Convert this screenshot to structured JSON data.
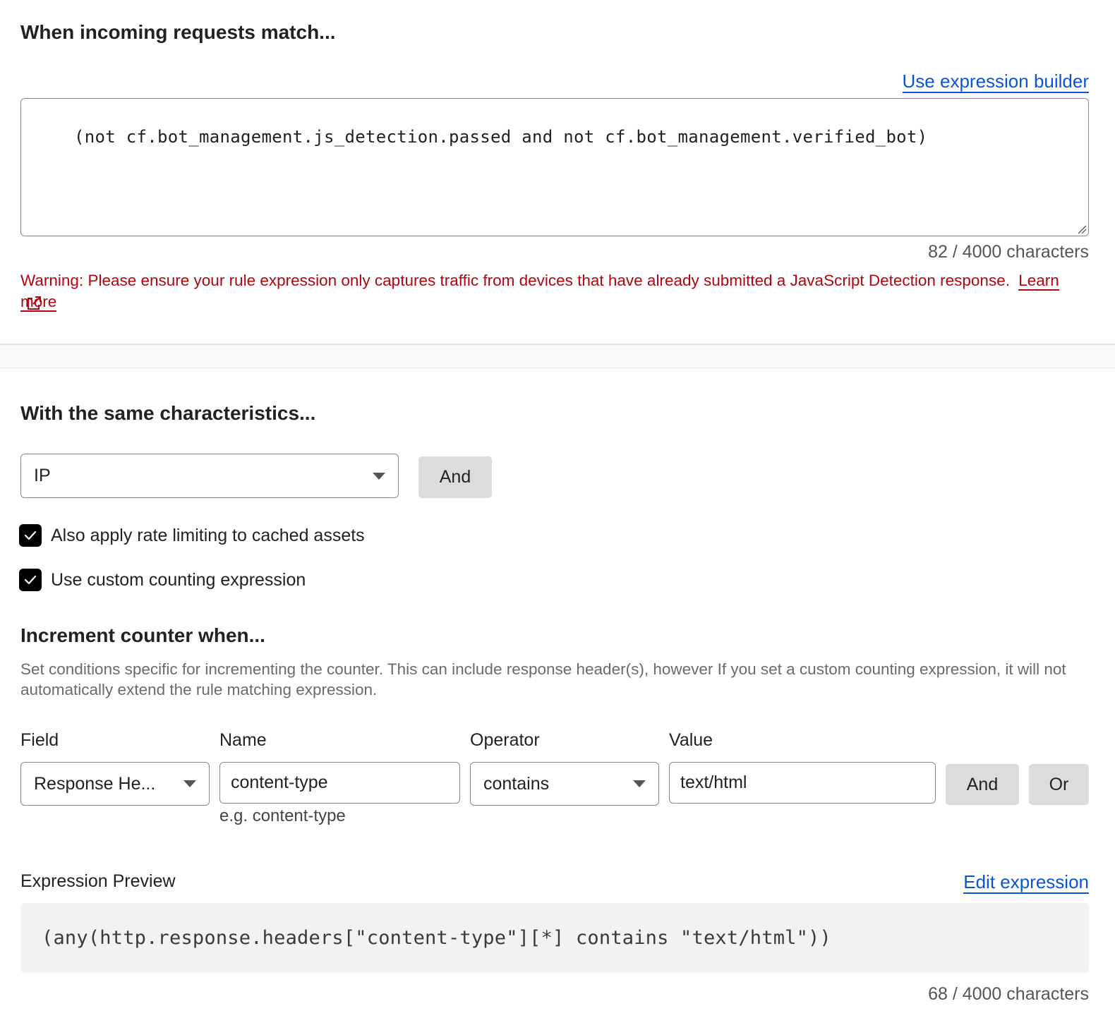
{
  "match_section": {
    "heading": "When incoming requests match...",
    "builder_link": "Use expression builder",
    "expression": "(not cf.bot_management.js_detection.passed and not cf.bot_management.verified_bot)",
    "char_count": "82 / 4000 characters",
    "warning_text": "Warning: Please ensure your rule expression only captures traffic from devices that have already submitted a JavaScript Detection response.",
    "learn_more": "Learn more"
  },
  "characteristics": {
    "heading": "With the same characteristics...",
    "select_value": "IP",
    "and_button": "And",
    "checkbox_cached": "Also apply rate limiting to cached assets",
    "checkbox_custom": "Use custom counting expression"
  },
  "counter": {
    "heading": "Increment counter when...",
    "description": "Set conditions specific for incrementing the counter. This can include response header(s), however If you set a custom counting expression, it will not automatically extend the rule matching expression.",
    "labels": {
      "field": "Field",
      "name": "Name",
      "operator": "Operator",
      "value": "Value"
    },
    "field_value": "Response He...",
    "name_value": "content-type",
    "name_hint": "e.g. content-type",
    "operator_value": "contains",
    "value_value": "text/html",
    "and_button": "And",
    "or_button": "Or"
  },
  "preview": {
    "label": "Expression Preview",
    "edit_link": "Edit expression",
    "expression": "(any(http.response.headers[\"content-type\"][*] contains \"text/html\"))",
    "char_count": "68 / 4000 characters"
  },
  "colors": {
    "link": "#0a55d6",
    "warning": "#b1060f",
    "button_grey": "#dcdcdc"
  }
}
